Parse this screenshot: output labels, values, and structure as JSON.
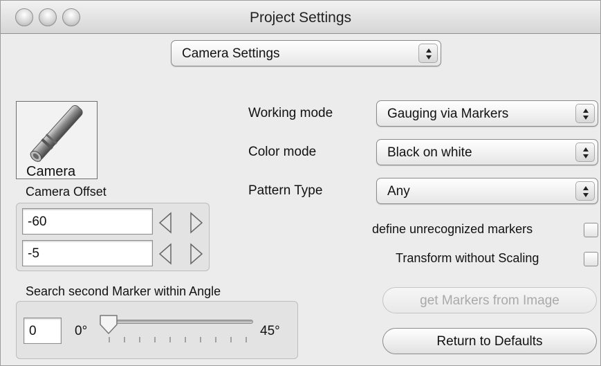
{
  "window": {
    "title": "Project Settings"
  },
  "settings_selector": {
    "value": "Camera Settings"
  },
  "camera": {
    "label": "Camera",
    "offset_label": "Camera Offset",
    "offset_x": "-60",
    "offset_y": "-5"
  },
  "working_mode": {
    "label": "Working mode",
    "value": "Gauging via Markers"
  },
  "color_mode": {
    "label": "Color mode",
    "value": "Black on white"
  },
  "pattern_type": {
    "label": "Pattern Type",
    "value": "Any"
  },
  "checkboxes": {
    "define_unrecognized": {
      "label": "define unrecognized markers",
      "checked": false
    },
    "transform_without_scaling": {
      "label": "Transform without Scaling",
      "checked": false
    }
  },
  "angle": {
    "label": "Search second Marker within Angle",
    "value": "0",
    "min_label": "0°",
    "max_label": "45°",
    "slider_fraction": 0
  },
  "buttons": {
    "get_markers": "get Markers from Image",
    "return_defaults": "Return to Defaults"
  },
  "icons": [
    "close-icon",
    "minimize-icon",
    "zoom-icon",
    "camera-icon",
    "popup-arrows-icon",
    "arrow-left-icon",
    "arrow-right-icon",
    "slider-knob-icon"
  ]
}
